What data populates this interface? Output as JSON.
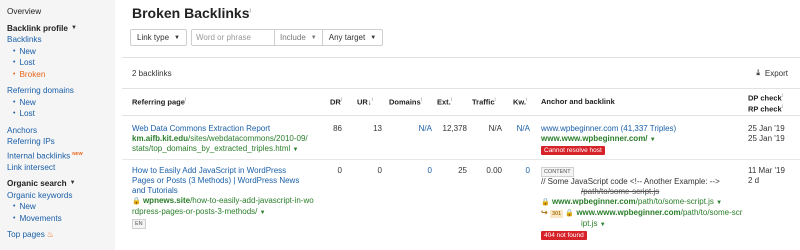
{
  "sidebar": {
    "overview": "Overview",
    "backlink_profile": "Backlink profile",
    "backlinks": "Backlinks",
    "backlinks_sub": [
      "New",
      "Lost",
      "Broken"
    ],
    "referring_domains": "Referring domains",
    "referring_domains_sub": [
      "New",
      "Lost"
    ],
    "anchors": "Anchors",
    "referring_ips": "Referring IPs",
    "internal_backlinks": "Internal backlinks",
    "new_badge": "NEW",
    "link_intersect": "Link intersect",
    "organic_search": "Organic search",
    "organic_keywords": "Organic keywords",
    "organic_keywords_sub": [
      "New",
      "Movements"
    ],
    "top_pages": "Top pages"
  },
  "header": {
    "title": "Broken Backlinks",
    "info": "i"
  },
  "filters": {
    "link_type": "Link type",
    "search_placeholder": "Word or phrase",
    "include": "Include",
    "any_target": "Any target"
  },
  "summary": {
    "count": "2 backlinks",
    "export": "Export"
  },
  "columns": {
    "referring_page": "Referring page",
    "dr": "DR",
    "ur": "UR",
    "domains": "Domains",
    "ext": "Ext.",
    "traffic": "Traffic",
    "kw": "Kw.",
    "anchor": "Anchor and backlink",
    "dp_check": "DP check",
    "rp_check": "RP check"
  },
  "rows": [
    {
      "title": "Web Data Commons Extraction Report",
      "domain_bold": "km.aifb.kit.edu",
      "path_line1": "/sites/webdatacommons/2010-09/",
      "path_line2": "stats/top_domains_by_extracted_triples.html",
      "dr": "86",
      "ur": "13",
      "domains": "N/A",
      "ext": "12,378",
      "traffic": "N/A",
      "kw": "N/A",
      "anchor_text": "www.wpbeginner.com (41,337 Triples)",
      "backlink": "www.www.wpbeginner.com/",
      "error": "Cannot resolve host",
      "dp": "25 Jan '19",
      "rp": "25 Jan '19"
    },
    {
      "title_line1": "How to Easily Add JavaScript in WordPress",
      "title_line2": "Pages or Posts (3 Methods) | WordPress News",
      "title_line3": "and Tutorials",
      "domain_bold": "wpnews.site",
      "path_line1": "/how-to-easily-add-javascript-in-wo",
      "path_line2": "rdpress-pages-or-posts-3-methods/",
      "lang": "EN",
      "dr": "0",
      "ur": "0",
      "domains": "0",
      "ext": "25",
      "traffic": "0.00",
      "kw": "0",
      "content_tag": "CONTENT",
      "anchor_text": "// Some JavaScript code <!-- Another Example: -->",
      "struck": "/path/to/some-script.js",
      "backlink1_bold": "www.wpbeginner.com",
      "backlink1_path": "/path/to/some-script.js",
      "redirect": "301",
      "backlink2_bold": "www.www.wpbeginner.com",
      "backlink2_path": "/path/to/some-scr",
      "backlink2_path2": "ipt.js",
      "error": "404 not found",
      "dp": "11 Mar '19",
      "rp": "2 d"
    }
  ],
  "colors": {
    "link": "#1a5fa8",
    "green": "#2a7d2a",
    "active": "#e8661a",
    "error": "#d6232a"
  }
}
